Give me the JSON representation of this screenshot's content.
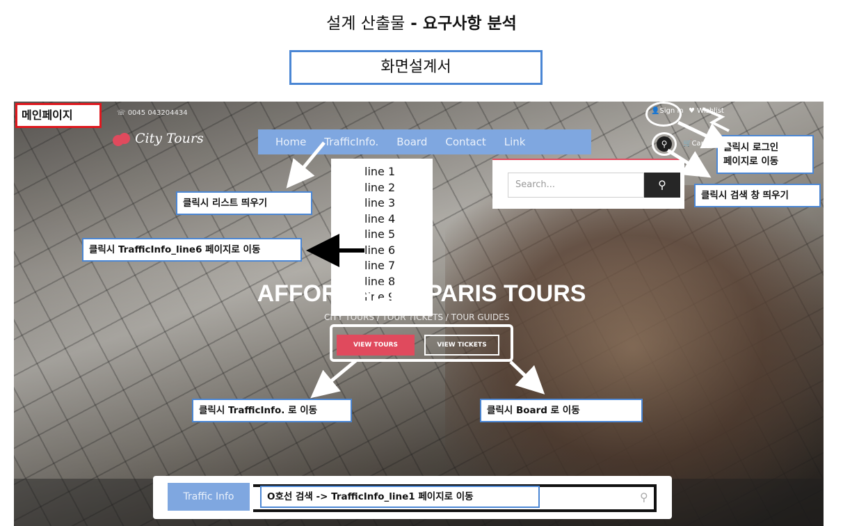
{
  "slide": {
    "title_prefix": "설계 산출물",
    "title_dash": "-",
    "title_main": "요구사항 분석",
    "subtitle": "화면설계서"
  },
  "page_tag": "메인페이지",
  "site": {
    "phone": "0045 043204434",
    "logo": "City Tours",
    "nav": [
      "Home",
      "TrafficInfo.",
      "Board",
      "Contact",
      "Link"
    ],
    "signin": "Sign in",
    "wishlist": "Wishlist",
    "cart": "Cart (0)",
    "dropdown": [
      "line 1",
      "line 2",
      "line 3",
      "line 4",
      "line 5",
      "line 6",
      "line 7",
      "line 8",
      "line 9"
    ],
    "search_placeholder": "Search...",
    "hero_title": "AFFORDABLE PARIS TOURS",
    "hero_sub": "CITY TOURS / TOUR TICKETS / TOUR GUIDES",
    "btn_tours": "VIEW TOURS",
    "btn_tickets": "VIEW TICKETS",
    "traffic_tab": "Traffic Info"
  },
  "notes": {
    "login": "클릭시 로그인\n페이지로 이동",
    "search": "클릭시 검색 창 띄우기",
    "list": "클릭시 리스트 띄우기",
    "line6": "클릭시 TrafficInfo_line6 페이지로 이동",
    "tours": "클릭시 TrafficInfo. 로 이동",
    "board": "클릭시 Board 로 이동",
    "bottom": "O호선 검색 -> TrafficInfo_line1 페이지로 이동"
  },
  "colors": {
    "nav_bg": "#7fa7e0",
    "accent": "#e04a5d",
    "note_border": "#4a86d4",
    "page_tag_border": "#e0181e"
  }
}
